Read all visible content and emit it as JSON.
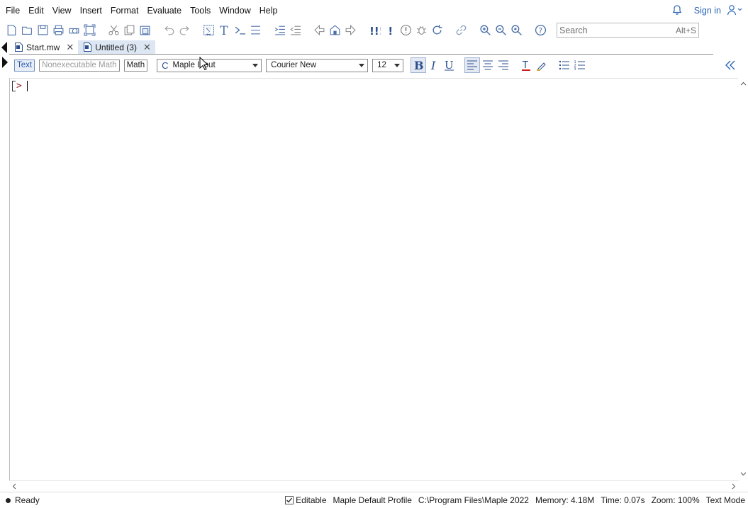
{
  "menubar": {
    "items": [
      "File",
      "Edit",
      "View",
      "Insert",
      "Format",
      "Evaluate",
      "Tools",
      "Window",
      "Help"
    ],
    "signin_label": "Sign in",
    "icons": [
      "bell-icon",
      "user-icon"
    ]
  },
  "toolbar": {
    "icons": [
      "new-icon",
      "open-icon",
      "save-icon",
      "print-icon",
      "print-preview-icon",
      "fullscreen-icon",
      "cut-icon",
      "copy-icon",
      "paste-icon",
      "undo-icon",
      "redo-icon",
      "math-icon",
      "text-icon",
      "execution-group-icon",
      "section-icon",
      "indent-icon",
      "outdent-icon",
      "back-icon",
      "home-icon",
      "forward-icon",
      "execute-all-icon",
      "execute-icon",
      "interrupt-icon",
      "debug-icon",
      "restart-icon",
      "link-icon",
      "zoom-in-icon",
      "zoom-out-icon",
      "zoom-reset-icon",
      "help-icon"
    ],
    "search": {
      "placeholder": "Search",
      "shortcut": "Alt+S"
    }
  },
  "tabs": [
    {
      "label": "Start.mw",
      "active": false
    },
    {
      "label": "Untitled (3)",
      "active": true
    }
  ],
  "formatbar": {
    "modes": [
      {
        "label": "Text",
        "state": "selected"
      },
      {
        "label": "Nonexecutable Math",
        "state": "disabled"
      },
      {
        "label": "Math",
        "state": "normal"
      }
    ],
    "style_select": "Maple Input",
    "font_select": "Courier New",
    "size_select": "12"
  },
  "document": {
    "prompt": ">"
  },
  "status": {
    "state": "Ready",
    "editable_label": "Editable",
    "editable_checked": true,
    "profile": "Maple Default Profile",
    "path": "C:\\Program Files\\Maple 2022",
    "memory": "Memory: 4.18M",
    "time": "Time: 0.07s",
    "zoom": "Zoom: 100%",
    "mode": "Text Mode"
  },
  "colors": {
    "link_blue": "#2a64b5",
    "prompt_red": "#9a1d1d",
    "tab_active": "#dde6f3"
  }
}
